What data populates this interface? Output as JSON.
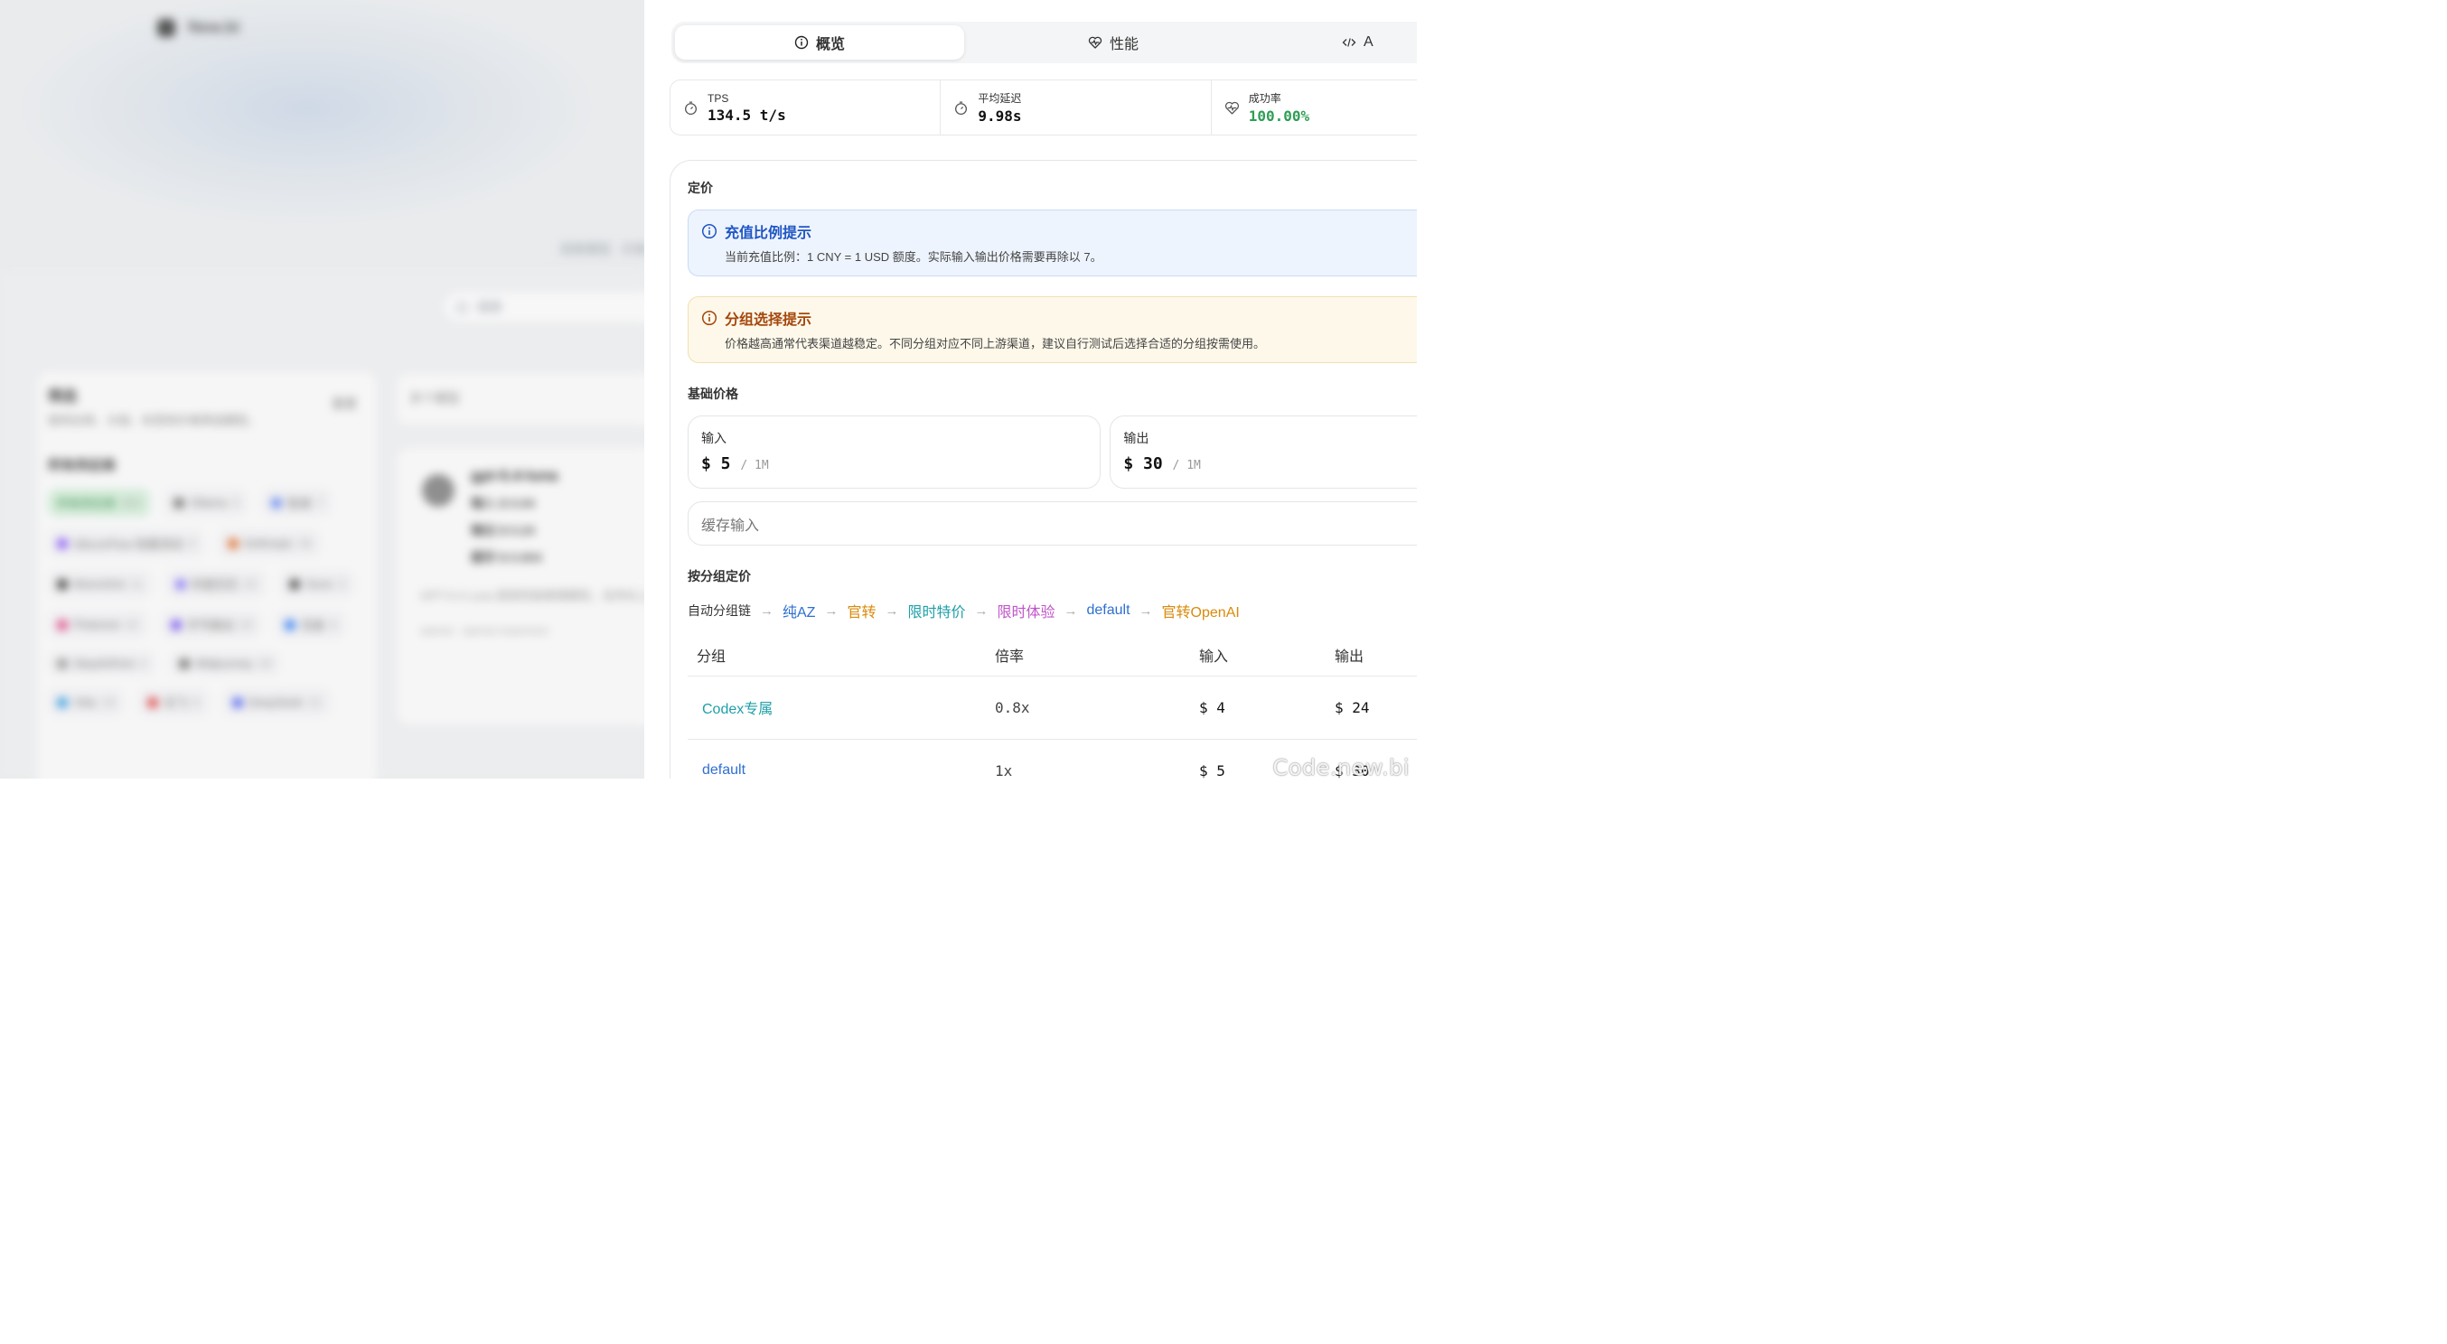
{
  "tabs": [
    {
      "label": "概览",
      "icon": "info-circle-icon"
    },
    {
      "label": "性能",
      "icon": "heart-pulse-icon"
    },
    {
      "label": "A",
      "icon": "code-icon"
    }
  ],
  "stats": [
    {
      "label": "TPS",
      "value": "134.5 t/s",
      "icon": "timer-icon"
    },
    {
      "label": "平均延迟",
      "value": "9.98s",
      "icon": "timer-icon"
    },
    {
      "label": "成功率",
      "value": "100.00%",
      "icon": "heart-pulse-icon",
      "color": "#2f9e55"
    }
  ],
  "pricing": {
    "title": "定价",
    "alert_ratio": {
      "title": "充值比例提示",
      "text": "当前充值比例：1 CNY = 1 USD 额度。实际输入输出价格需要再除以 7。"
    },
    "alert_group": {
      "title": "分组选择提示",
      "text": "价格越高通常代表渠道越稳定。不同分组对应不同上游渠道，建议自行测试后选择合适的分组按需使用。"
    },
    "base_title": "基础价格",
    "input": {
      "label": "输入",
      "price": "$ 5",
      "unit": "/ 1M"
    },
    "output": {
      "label": "输出",
      "price": "$ 30",
      "unit": "/ 1M"
    },
    "cache_label": "缓存输入",
    "group_title": "按分组定价",
    "chain_label": "自动分组链",
    "chain": [
      {
        "name": "纯AZ",
        "color": "#2f6fcf"
      },
      {
        "name": "官转",
        "color": "#d98a0b"
      },
      {
        "name": "限时特价",
        "color": "#1e9fa8"
      },
      {
        "name": "限时体验",
        "color": "#c054c9"
      },
      {
        "name": "default",
        "color": "#2f6fcf"
      },
      {
        "name": "官转OpenAI",
        "color": "#d98a0b"
      }
    ],
    "table": {
      "headers": [
        "分组",
        "倍率",
        "输入",
        "输出"
      ],
      "rows": [
        {
          "group": "Codex专属",
          "color": "#1e9fa8",
          "rate": "0.8x",
          "input": "$ 4",
          "output": "$ 24"
        },
        {
          "group": "default",
          "color": "#2f6fcf",
          "rate": "1x",
          "input": "$ 5",
          "output": "$ 30"
        }
      ]
    }
  },
  "background": {
    "logo": "New.bi",
    "subtitle": "探索模型 · 价格 · 性能",
    "search_placeholder": "搜索",
    "filter_title": "筛选",
    "filter_desc": "按供应商、分组、标签和价格筛选模型。",
    "reset_label": "重置",
    "vendors_title": "所有供应商",
    "vendor_chips": [
      {
        "name": "所有供应商",
        "count": "364"
      },
      {
        "name": "Ollama",
        "count": "3"
      },
      {
        "name": "智谱",
        "count": "7"
      },
      {
        "name": "SiliconFlow 硅基流动",
        "count": "4"
      },
      {
        "name": "Anthropic",
        "count": "36"
      },
      {
        "name": "Moonshot",
        "count": "11"
      },
      {
        "name": "阿里巴巴",
        "count": "22"
      },
      {
        "name": "Suno",
        "count": "3"
      },
      {
        "name": "Pinterest",
        "count": "15"
      },
      {
        "name": "字节跳动",
        "count": "23"
      },
      {
        "name": "百度",
        "count": "6"
      },
      {
        "name": "StepAI/Kimi",
        "count": "2"
      },
      {
        "name": "Midjourney",
        "count": "18"
      },
      {
        "name": "Vidu",
        "count": "19"
      },
      {
        "name": "讯飞",
        "count": "6"
      },
      {
        "name": "DeepSeek",
        "count": "21"
      }
    ],
    "list_title": "多个模型",
    "card": {
      "name": "gpt-5.4-luna",
      "lines": [
        "输入 $ 0.04",
        "输出 $ 0.24",
        "缓存 $ 0.004"
      ],
      "desc": "GPT-5.4 Luna 是高性能推理模型，支持长上下文与工具调用。",
      "tags": "openai · openai-responses"
    }
  },
  "watermark": "Code.new.bi"
}
